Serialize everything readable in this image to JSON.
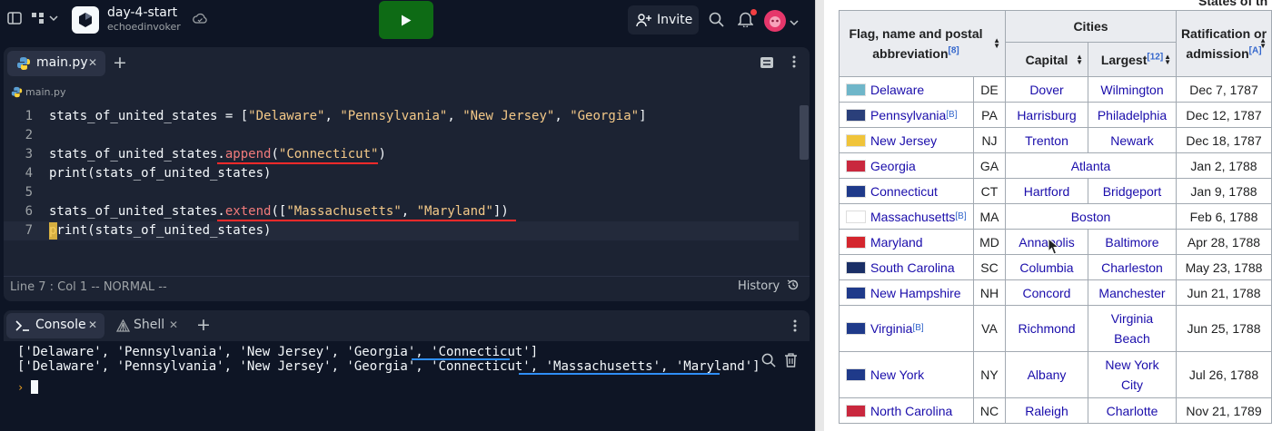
{
  "ide": {
    "project_name": "day-4-start",
    "project_owner": "echoedinvoker",
    "invite_label": "Invite",
    "editor_tab_label": "main.py",
    "breadcrumb": "main.py",
    "status_text": "Line 7 : Col 1   -- NORMAL --",
    "history_label": "History",
    "console_tab_label": "Console",
    "shell_tab_label": "Shell",
    "console_output": [
      "['Delaware', 'Pennsylvania', 'New Jersey', 'Georgia', 'Connecticut']",
      "['Delaware', 'Pennsylvania', 'New Jersey', 'Georgia', 'Connecticut', 'Massachusetts', 'Maryland']"
    ],
    "code_lines": [
      {
        "num": "1",
        "text": "stats_of_united_states = [\"Delaware\", \"Pennsylvania\", \"New Jersey\", \"Georgia\"]"
      },
      {
        "num": "2",
        "text": ""
      },
      {
        "num": "3",
        "text": "stats_of_united_states.append(\"Connecticut\")"
      },
      {
        "num": "4",
        "text": "print(stats_of_united_states)"
      },
      {
        "num": "5",
        "text": ""
      },
      {
        "num": "6",
        "text": "stats_of_united_states.extend([\"Massachusetts\", \"Maryland\"])"
      },
      {
        "num": "7",
        "text": "print(stats_of_united_states)"
      }
    ],
    "colors": {
      "run_button": "#0e6b15",
      "error_underline": "#ff2a2a",
      "output_underline": "#2f8ef5"
    }
  },
  "wiki": {
    "caption": "States of th",
    "headers": {
      "flag_name": "Flag, name and postal abbreviation",
      "flag_name_ref": "[8]",
      "cities": "Cities",
      "capital": "Capital",
      "largest": "Largest",
      "largest_ref": "[12]",
      "ratification": "Ratification or admission",
      "ratification_ref": "[A]"
    },
    "rows": [
      {
        "name": "Delaware",
        "ref": "",
        "abbr": "DE",
        "capital": "Dover",
        "largest": "Wilmington",
        "date": "Dec 7, 1787"
      },
      {
        "name": "Pennsylvania",
        "ref": "[B]",
        "abbr": "PA",
        "capital": "Harrisburg",
        "largest": "Philadelphia",
        "date": "Dec 12, 1787"
      },
      {
        "name": "New Jersey",
        "ref": "",
        "abbr": "NJ",
        "capital": "Trenton",
        "largest": "Newark",
        "date": "Dec 18, 1787"
      },
      {
        "name": "Georgia",
        "ref": "",
        "abbr": "GA",
        "capital": "Atlanta",
        "largest": "",
        "date": "Jan 2, 1788"
      },
      {
        "name": "Connecticut",
        "ref": "",
        "abbr": "CT",
        "capital": "Hartford",
        "largest": "Bridgeport",
        "date": "Jan 9, 1788"
      },
      {
        "name": "Massachusetts",
        "ref": "[B]",
        "abbr": "MA",
        "capital": "Boston",
        "largest": "",
        "date": "Feb 6, 1788"
      },
      {
        "name": "Maryland",
        "ref": "",
        "abbr": "MD",
        "capital": "Annapolis",
        "largest": "Baltimore",
        "date": "Apr 28, 1788"
      },
      {
        "name": "South Carolina",
        "ref": "",
        "abbr": "SC",
        "capital": "Columbia",
        "largest": "Charleston",
        "date": "May 23, 1788"
      },
      {
        "name": "New Hampshire",
        "ref": "",
        "abbr": "NH",
        "capital": "Concord",
        "largest": "Manchester",
        "date": "Jun 21, 1788"
      },
      {
        "name": "Virginia",
        "ref": "[B]",
        "abbr": "VA",
        "capital": "Richmond",
        "largest": "Virginia Beach",
        "date": "Jun 25, 1788"
      },
      {
        "name": "New York",
        "ref": "",
        "abbr": "NY",
        "capital": "Albany",
        "largest": "New York City",
        "date": "Jul 26, 1788"
      },
      {
        "name": "North Carolina",
        "ref": "",
        "abbr": "NC",
        "capital": "Raleigh",
        "largest": "Charlotte",
        "date": "Nov 21, 1789"
      }
    ]
  }
}
